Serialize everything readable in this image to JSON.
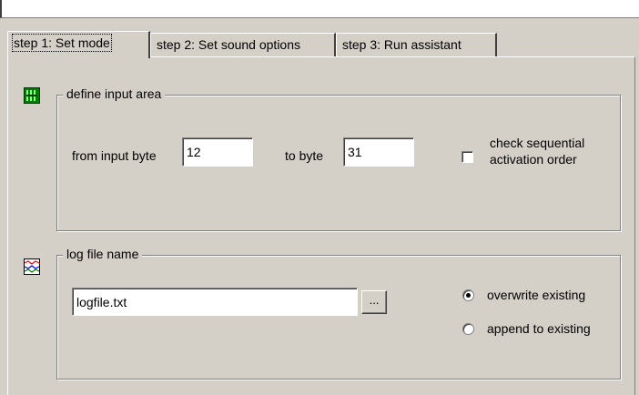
{
  "tabs": [
    {
      "label": "step 1: Set mode",
      "active": true
    },
    {
      "label": "step 2: Set sound options",
      "active": false
    },
    {
      "label": "step 3: Run assistant",
      "active": false
    }
  ],
  "input_area": {
    "title": "define input area",
    "icon": "input-module-icon",
    "from_label": "from input byte",
    "from_value": "12",
    "to_label": "to byte",
    "to_value": "31",
    "check_sequential_label_line1": "check sequential",
    "check_sequential_label_line2": "activation order",
    "check_sequential_checked": false
  },
  "log_file": {
    "title": "log file name",
    "icon": "log-chart-icon",
    "file_name": "logfile.txt",
    "browse_label": "...",
    "overwrite_label": "overwrite existing",
    "append_label": "append to existing",
    "selected": "overwrite"
  },
  "colors": {
    "face": "#d4d0c8",
    "shadow": "#808080",
    "highlight": "#ffffff",
    "icon_green": "#00a000"
  }
}
